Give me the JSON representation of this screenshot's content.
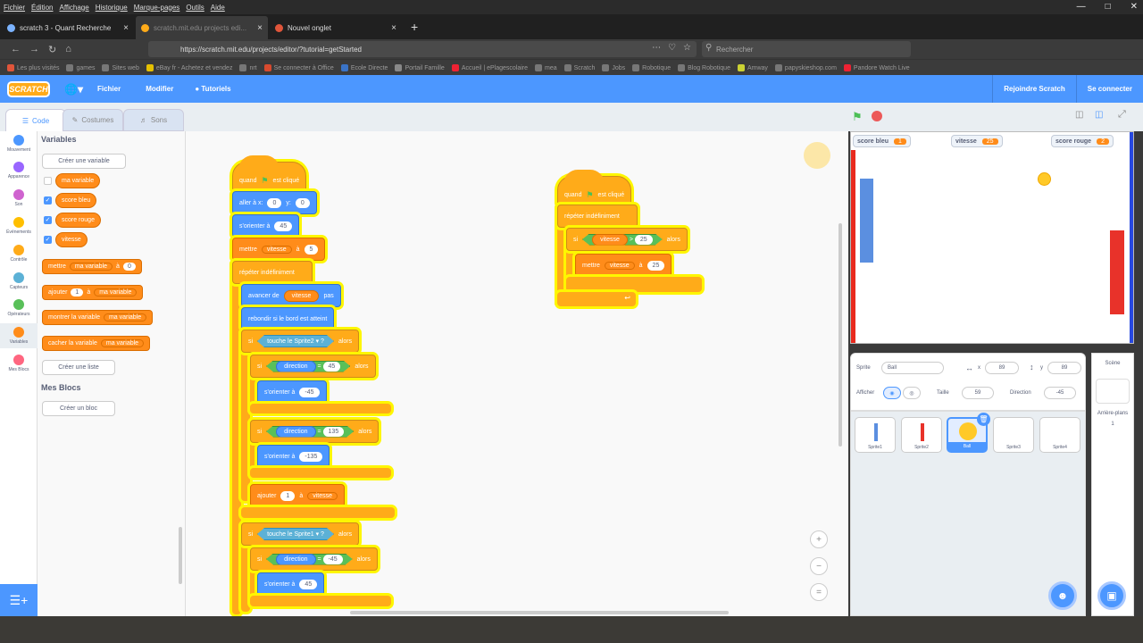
{
  "browser": {
    "menu": [
      "Fichier",
      "Édition",
      "Affichage",
      "Historique",
      "Marque-pages",
      "Outils",
      "Aide"
    ],
    "tabs": [
      {
        "title": "scratch 3 - Quant Recherche"
      },
      {
        "title": "scratch.mit.edu projects edi..."
      },
      {
        "title": "Nouvel onglet"
      }
    ],
    "url": "https://scratch.mit.edu/projects/editor/?tutorial=getStarted",
    "search_placeholder": "Rechercher",
    "bookmarks": [
      "Les plus visités",
      "games",
      "Sites web",
      "eBay fr - Achetez et vendez",
      "nrt",
      "Se connecter à Office",
      "Ecole Directe",
      "Portail Famille",
      "Accueil | ePlagescolaire",
      "mea",
      "Scratch",
      "Jobs",
      "Robotique",
      "Blog Robotique",
      "Amway",
      "papyskieshop.com",
      "Pandore Watch Live"
    ]
  },
  "header": {
    "logo": "SCRATCH",
    "file": "Fichier",
    "edit": "Modifier",
    "tutorials": "Tutoriels",
    "join": "Rejoindre Scratch",
    "signin": "Se connecter"
  },
  "tabs": {
    "code": "Code",
    "costumes": "Costumes",
    "sounds": "Sons"
  },
  "categories": [
    {
      "label": "Mouvement",
      "color": "#4c97ff"
    },
    {
      "label": "Apparence",
      "color": "#9966ff"
    },
    {
      "label": "Son",
      "color": "#cf63cf"
    },
    {
      "label": "Événements",
      "color": "#ffbf00"
    },
    {
      "label": "Contrôle",
      "color": "#ffab19"
    },
    {
      "label": "Capteurs",
      "color": "#5cb1d6"
    },
    {
      "label": "Opérateurs",
      "color": "#59c059"
    },
    {
      "label": "Variables",
      "color": "#ff8c1a"
    },
    {
      "label": "Mes Blocs",
      "color": "#ff6680"
    }
  ],
  "palette": {
    "title": "Variables",
    "create_var": "Créer une variable",
    "vars": [
      {
        "name": "ma variable",
        "checked": false
      },
      {
        "name": "score bleu",
        "checked": true
      },
      {
        "name": "score rouge",
        "checked": true
      },
      {
        "name": "vitesse",
        "checked": true
      }
    ],
    "set": "mettre",
    "set_var": "ma variable",
    "to": "à",
    "set_val": "0",
    "change": "ajouter",
    "change_val": "1",
    "change_to": "à",
    "change_var": "ma variable",
    "show": "montrer la variable",
    "show_var": "ma variable",
    "hide": "cacher la variable",
    "hide_var": "ma variable",
    "create_list": "Créer une liste",
    "myblocks_title": "Mes Blocs",
    "create_block": "Créer un bloc"
  },
  "script1": {
    "hat": "quand",
    "hat2": "est cliqué",
    "goto": "aller à x:",
    "goto_x": "0",
    "goto_y_label": "y:",
    "goto_y": "0",
    "point": "s'orienter à",
    "point_val": "45",
    "set": "mettre",
    "set_var": "vitesse",
    "set_to": "à",
    "set_val": "5",
    "forever": "répéter indéfiniment",
    "move": "avancer de",
    "move_var": "vitesse",
    "move_unit": "pas",
    "bounce": "rebondir si le bord est atteint",
    "if1": "si",
    "touch1": "touche le",
    "touch1_obj": "Sprite2",
    "q": "?",
    "then": "alors",
    "if1a_dir": "direction",
    "if1a_eq": "=",
    "if1a_val": "45",
    "if1a_point": "s'orienter à",
    "if1a_point_val": "-45",
    "if1b_dir": "direction",
    "if1b_val": "135",
    "if1b_point": "s'orienter à",
    "if1b_point_val": "-135",
    "change": "ajouter",
    "change_val": "1",
    "change_to": "à",
    "change_var": "vitesse",
    "touch2_obj": "Sprite1",
    "if2a_dir": "direction",
    "if2a_val": "-45",
    "if2a_point": "s'orienter à",
    "if2a_point_val": "45"
  },
  "script2": {
    "hat": "quand",
    "hat2": "est cliqué",
    "forever": "répéter indéfiniment",
    "if": "si",
    "var": "vitesse",
    "gt": ">",
    "cmp": "25",
    "then": "alors",
    "set": "mettre",
    "set_var": "vitesse",
    "set_to": "à",
    "set_val": "25"
  },
  "stage": {
    "monitors": [
      {
        "name": "score bleu",
        "value": "1"
      },
      {
        "name": "vitesse",
        "value": "25"
      },
      {
        "name": "score rouge",
        "value": "2"
      }
    ]
  },
  "sprite_info": {
    "sprite_label": "Sprite",
    "sprite_name": "Ball",
    "x_val": "89",
    "y_val": "89",
    "show_label": "Afficher",
    "size_label": "Taille",
    "size": "59",
    "dir_label": "Direction",
    "dir": "-45"
  },
  "sprites": [
    {
      "name": "Sprite1"
    },
    {
      "name": "Sprite2"
    },
    {
      "name": "Ball"
    },
    {
      "name": "Sprite3"
    },
    {
      "name": "Sprite4"
    }
  ],
  "scene": {
    "title": "Scène",
    "backdrops_label": "Arrière-plans",
    "backdrops": "1"
  },
  "colors": {
    "scratch_blue": "#4c97ff",
    "control": "#ffab19",
    "variables": "#ff8c1a",
    "highlight": "#fef600"
  }
}
